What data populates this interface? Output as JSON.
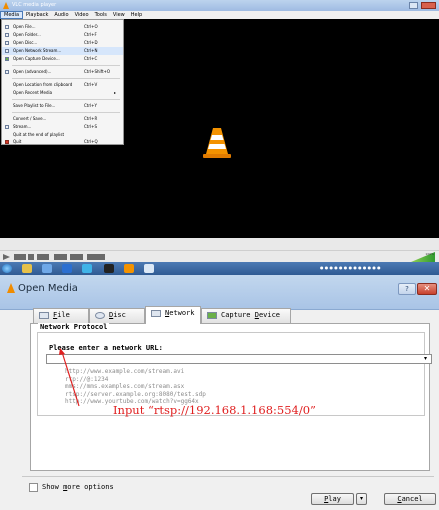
{
  "vlc": {
    "title": "VLC media player",
    "menubar": [
      "Media",
      "Playback",
      "Audio",
      "Video",
      "Tools",
      "View",
      "Help"
    ],
    "media_menu": [
      {
        "label": "Open File...",
        "shortcut": "Ctrl+O",
        "icon": "file-icon"
      },
      {
        "label": "Open Folder...",
        "shortcut": "Ctrl+F",
        "icon": "folder-icon"
      },
      {
        "label": "Open Disc...",
        "shortcut": "Ctrl+D",
        "icon": "disc-icon"
      },
      {
        "label": "Open Network Stream...",
        "shortcut": "Ctrl+N",
        "icon": "network-icon"
      },
      {
        "label": "Open Capture Device...",
        "shortcut": "Ctrl+C",
        "icon": "capture-icon"
      },
      {
        "label": "Open (advanced)...",
        "shortcut": "Ctrl+Shift+O",
        "icon": "file-icon"
      },
      {
        "label": "Open Location from clipboard",
        "shortcut": "Ctrl+V",
        "icon": ""
      },
      {
        "label": "Open Recent Media",
        "shortcut": "▸",
        "icon": ""
      },
      {
        "label": "Save Playlist to File...",
        "shortcut": "Ctrl+Y",
        "icon": ""
      },
      {
        "label": "Convert / Save...",
        "shortcut": "Ctrl+R",
        "icon": ""
      },
      {
        "label": "Stream...",
        "shortcut": "Ctrl+S",
        "icon": "stream-icon"
      },
      {
        "label": "Quit at the end of playlist",
        "shortcut": "",
        "icon": ""
      },
      {
        "label": "Quit",
        "shortcut": "Ctrl+Q",
        "icon": "quit-icon"
      }
    ],
    "volume": "100%"
  },
  "dialog": {
    "title": "Open Media",
    "help": "?",
    "close": "✕",
    "tabs": [
      {
        "key": "F",
        "rest": "ile"
      },
      {
        "key": "D",
        "rest": "isc"
      },
      {
        "key": "N",
        "rest": "etwork"
      },
      {
        "pre": "Capture ",
        "key": "D",
        "rest": "evice"
      }
    ],
    "network_protocol_legend": "Network Protocol",
    "url_label": "Please enter a network URL:",
    "url_value": "",
    "examples": [
      "http://www.example.com/stream.avi",
      "rtp://@:1234",
      "mms://mms.examples.com/stream.asx",
      "rtsp://server.example.org:8080/test.sdp",
      "http://www.yourtube.com/watch?v=gg64x"
    ],
    "annotation": "Input “rtsp://192.168.1.168:554/0”",
    "show_more_key": "m",
    "show_more_pre": "Show ",
    "show_more_rest": "ore options",
    "play_key": "P",
    "play_rest": "lay",
    "cancel_key": "C",
    "cancel_rest": "ancel",
    "colors": {
      "annotation": "#e02020",
      "titlebar": "#b6cdea"
    }
  }
}
